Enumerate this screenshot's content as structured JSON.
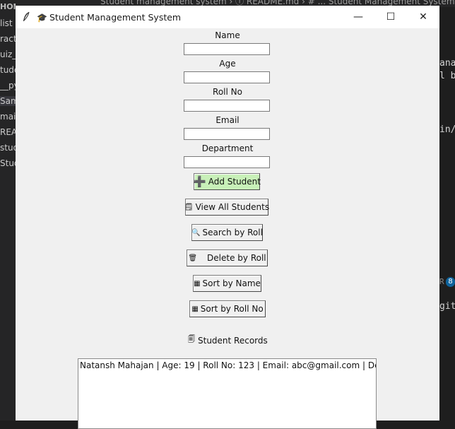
{
  "background": {
    "explorer_items": [
      "HON PROJECTS",
      "list",
      "ract",
      "uiz_",
      "tude",
      "__py",
      "Sam",
      "mai",
      "REA",
      "stud",
      "Stud"
    ],
    "tab_text": "Student management system  ›  ⓘ README.md  ›  # ...  Student Management System",
    "code_lines": [
      "anag",
      "l b",
      "in/",
      "R",
      "git"
    ],
    "badge_count": "8"
  },
  "window": {
    "title": "Student Management System",
    "title_icon": "graduation-cap-icon",
    "controls": {
      "minimize": "—",
      "maximize": "☐",
      "close": "✕"
    }
  },
  "form": {
    "fields": [
      {
        "label": "Name",
        "value": ""
      },
      {
        "label": "Age",
        "value": ""
      },
      {
        "label": "Roll No",
        "value": ""
      },
      {
        "label": "Email",
        "value": ""
      },
      {
        "label": "Department",
        "value": ""
      }
    ]
  },
  "buttons": {
    "add": {
      "label": "Add Student",
      "icon": "➕"
    },
    "view_all": {
      "label": "View All Students",
      "icon": "🗒"
    },
    "search": {
      "label": "Search by Roll",
      "icon": "🔍"
    },
    "delete": {
      "label": "Delete by Roll",
      "icon": "🗑"
    },
    "sort_name": {
      "label": "Sort by Name",
      "icon": "▦"
    },
    "sort_roll": {
      "label": "Sort by Roll No",
      "icon": "▦"
    }
  },
  "records": {
    "title": "Student Records",
    "icon": "🗐",
    "rows": [
      "Natansh Mahajan | Age: 19 | Roll No: 123 | Email: abc@gmail.com | Dept: CSE AI"
    ]
  },
  "colors": {
    "add_button_bg": "#c8f0b8",
    "window_bg": "#f0f0f0"
  }
}
